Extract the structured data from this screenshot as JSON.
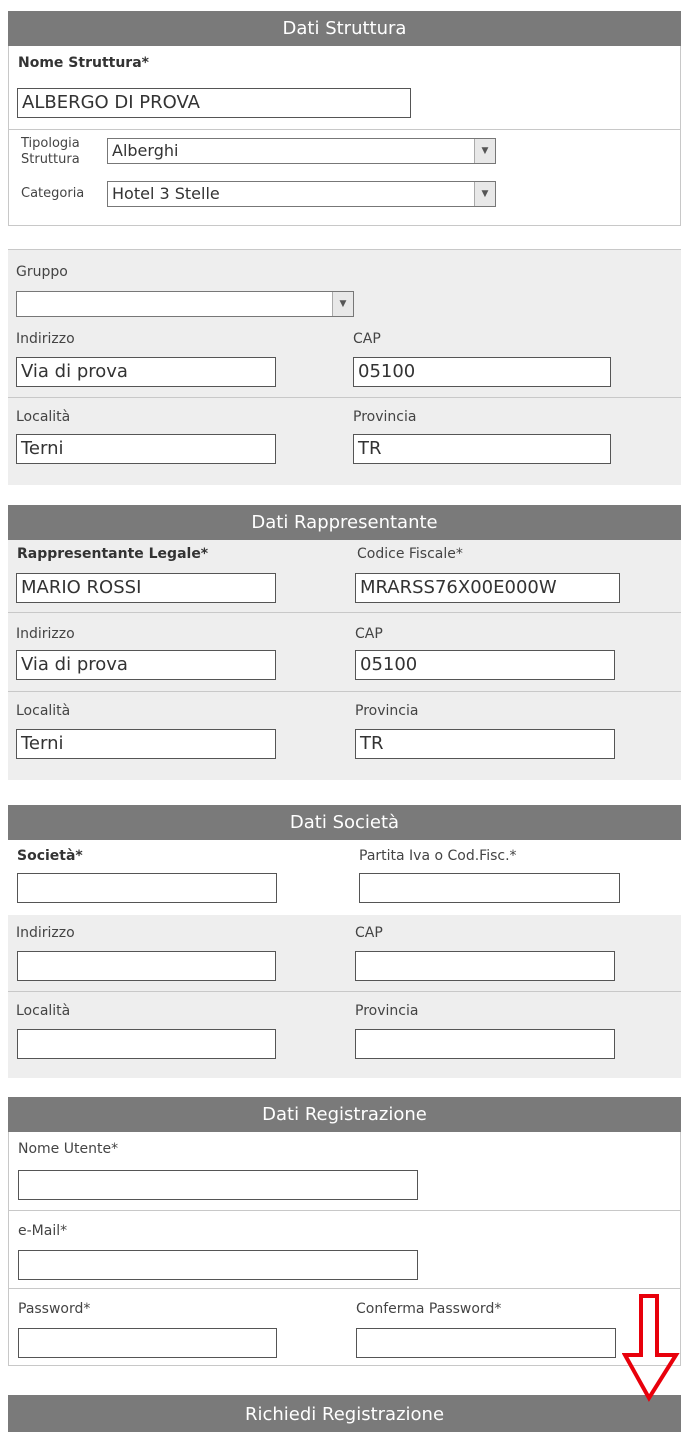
{
  "struttura": {
    "header": "Dati Struttura",
    "nome_label": "Nome Struttura*",
    "nome_value": "ALBERGO DI PROVA",
    "tipologia_label_1": "Tipologia",
    "tipologia_label_2": "Struttura",
    "tipologia_value": "Alberghi",
    "categoria_label": "Categoria",
    "categoria_value": "Hotel 3 Stelle",
    "gruppo_label": "Gruppo",
    "gruppo_value": "",
    "indirizzo_label": "Indirizzo",
    "indirizzo_value": "Via di prova",
    "cap_label": "CAP",
    "cap_value": "05100",
    "localita_label": "Località",
    "localita_value": "Terni",
    "provincia_label": "Provincia",
    "provincia_value": "TR"
  },
  "rappresentante": {
    "header": "Dati Rappresentante",
    "nome_label": "Rappresentante Legale*",
    "nome_value": "MARIO ROSSI",
    "cf_label": "Codice Fiscale*",
    "cf_value": "MRARSS76X00E000W",
    "indirizzo_label": "Indirizzo",
    "indirizzo_value": "Via di prova",
    "cap_label": "CAP",
    "cap_value": "05100",
    "localita_label": "Località",
    "localita_value": "Terni",
    "provincia_label": "Provincia",
    "provincia_value": "TR"
  },
  "societa": {
    "header": "Dati Società",
    "nome_label": "Società*",
    "piva_label": "Partita Iva o Cod.Fisc.*",
    "indirizzo_label": "Indirizzo",
    "cap_label": "CAP",
    "localita_label": "Località",
    "provincia_label": "Provincia"
  },
  "registrazione": {
    "header": "Dati Registrazione",
    "utente_label": "Nome Utente*",
    "email_label": "e-Mail*",
    "password_label": "Password*",
    "conferma_label": "Conferma Password*"
  },
  "submit_label": "Richiedi Registrazione",
  "colors": {
    "header_bg": "#7a7a7a",
    "section_bg": "#eeeeee",
    "arrow": "#e8000b"
  },
  "icons": {
    "dropdown": "chevron-down-icon",
    "annotation": "arrow-down-icon"
  }
}
